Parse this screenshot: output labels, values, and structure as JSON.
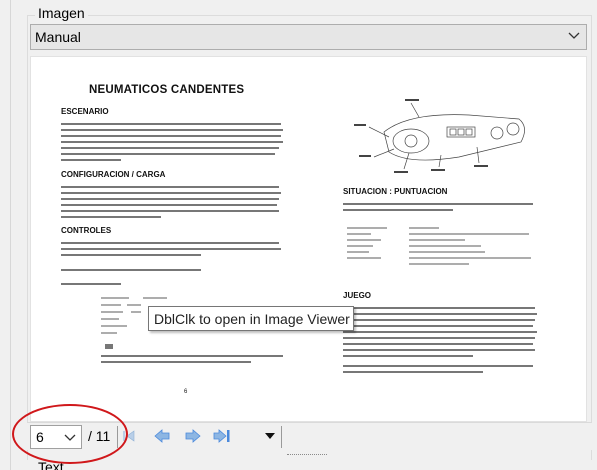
{
  "group": {
    "title": "Imagen"
  },
  "mode_combo": {
    "value": "Manual"
  },
  "document_preview": {
    "title": "NEUMATICOS CANDENTES",
    "sections": [
      "ESCENARIO",
      "CONFIGURACION / CARGA",
      "CONTROLES",
      "SITUACION : PUNTUACION",
      "JUEGO"
    ],
    "page_number_mark": "6"
  },
  "tooltip": {
    "text": "DblClk to open in Image Viewer"
  },
  "pager": {
    "current_page": "6",
    "total": "/ 11"
  },
  "next_group": {
    "title": "Text"
  },
  "icons": {
    "combo_arrow": "chevron-down-icon",
    "first": "first-page-icon",
    "prev": "previous-page-icon",
    "next": "next-page-icon",
    "last": "last-page-icon",
    "menu": "dropdown-triangle-icon"
  },
  "colors": {
    "annotation_circle": "#d0181b",
    "nav_icon": "#4a89dc"
  }
}
